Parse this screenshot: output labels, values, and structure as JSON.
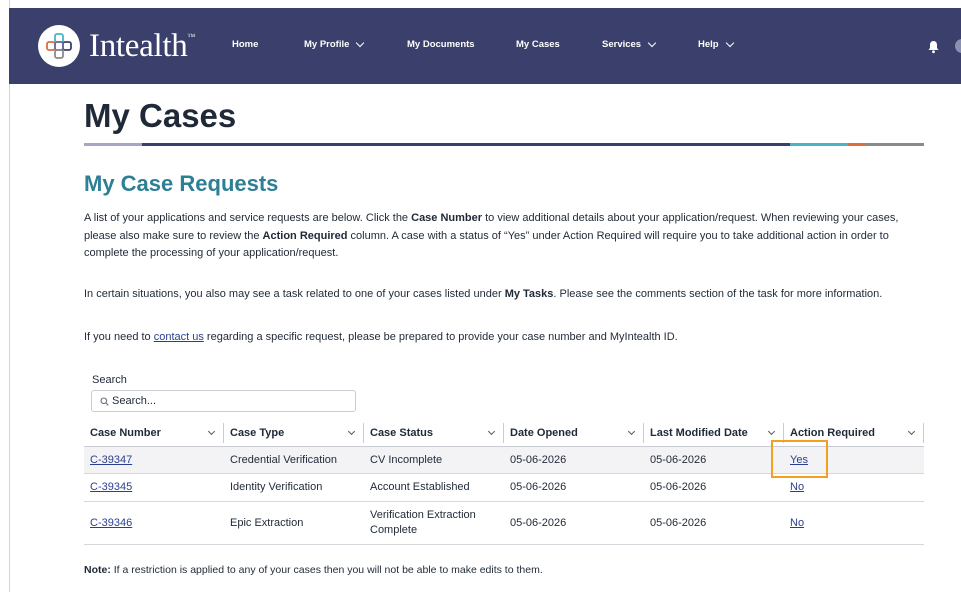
{
  "header": {
    "brand": "Intealth",
    "brand_mark": "™",
    "nav": [
      {
        "label": "Home"
      },
      {
        "label": "My Profile"
      },
      {
        "label": "My Documents"
      },
      {
        "label": "My Cases"
      },
      {
        "label": "Services"
      },
      {
        "label": "Help"
      }
    ]
  },
  "page": {
    "title": "My Cases",
    "section_heading": "My Case Requests",
    "para1": {
      "a": "A list of your applications and service requests are below. Click the ",
      "b": "Case Number",
      "c": " to view additional details about your application/request. When reviewing your cases, please also make sure to review the ",
      "d": "Action Required",
      "e": " column. A case with a status of “Yes” under Action Required will require you to take additional action in order to complete the processing of your application/request."
    },
    "para2": {
      "a": "In certain situations, you also may see a task related to one of your cases listed under ",
      "b": "My Tasks",
      "c": ". Please see the comments section of the task for more information."
    },
    "para3": {
      "a": "If you need to ",
      "link": "contact us",
      "b": " regarding a specific request, please be prepared to provide your case number and MyIntealth ID."
    }
  },
  "search": {
    "label": "Search",
    "placeholder": "Search..."
  },
  "table": {
    "columns": [
      "Case Number",
      "Case Type",
      "Case Status",
      "Date Opened",
      "Last Modified Date",
      "Action Required"
    ],
    "rows": [
      {
        "case_number": "C-39347",
        "case_type": "Credential Verification",
        "case_status": "CV Incomplete",
        "date_opened": "05-06-2026",
        "last_modified": "05-06-2026",
        "action_required": "Yes"
      },
      {
        "case_number": "C-39345",
        "case_type": "Identity Verification",
        "case_status": "Account Established",
        "date_opened": "05-06-2026",
        "last_modified": "05-06-2026",
        "action_required": "No"
      },
      {
        "case_number": "C-39346",
        "case_type": "Epic Extraction",
        "case_status": "Verification Extraction Complete",
        "date_opened": "05-06-2026",
        "last_modified": "05-06-2026",
        "action_required": "No"
      }
    ]
  },
  "note": {
    "label": "Note:",
    "text": " If a restriction is applied to any of your cases then you will not be able to make edits to them."
  },
  "colors": {
    "header_bg": "#3b3f6b",
    "heading_teal": "#2d7f95",
    "link": "#2a3f8f",
    "highlight": "#f2a01f"
  }
}
